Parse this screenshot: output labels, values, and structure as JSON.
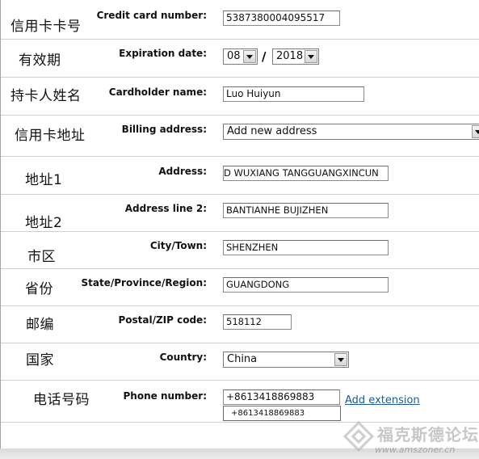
{
  "rows": [
    {
      "cn": "信用卡卡号",
      "label": "Credit card number:",
      "value": "5387380004095517"
    },
    {
      "cn": "有效期",
      "label": "Expiration date:",
      "month": "08",
      "separator": "/",
      "year": "2018"
    },
    {
      "cn": "持卡人姓名",
      "label": "Cardholder name:",
      "value": "Luo Huiyun"
    },
    {
      "cn": "信用卡地址",
      "label": "Billing address:",
      "value": "Add new address"
    },
    {
      "cn": "地址1",
      "label": "Address:",
      "value": "D WUXIANG TANGGUANGXINCUN"
    },
    {
      "cn": "地址2",
      "label": "Address line 2:",
      "value": "BANTIANHE BUJIZHEN"
    },
    {
      "cn": "市区",
      "label": "City/Town:",
      "value": "SHENZHEN"
    },
    {
      "cn": "省份",
      "label": "State/Province/Region:",
      "value": "GUANGDONG"
    },
    {
      "cn": "邮编",
      "label": "Postal/ZIP code:",
      "value": "518112"
    },
    {
      "cn": "国家",
      "label": "Country:",
      "value": "China"
    },
    {
      "cn": "电话号码",
      "label": "Phone number:",
      "value": "+8613418869883",
      "extension_link": "Add extension",
      "autocomplete": "+8613418869883"
    }
  ],
  "watermark": {
    "text": "福克斯德论坛",
    "url": "www.amszoner.cn"
  },
  "colors": {
    "link": "#1a5a9c",
    "border": "#8a8a8a",
    "divider": "#cfcfcf"
  }
}
